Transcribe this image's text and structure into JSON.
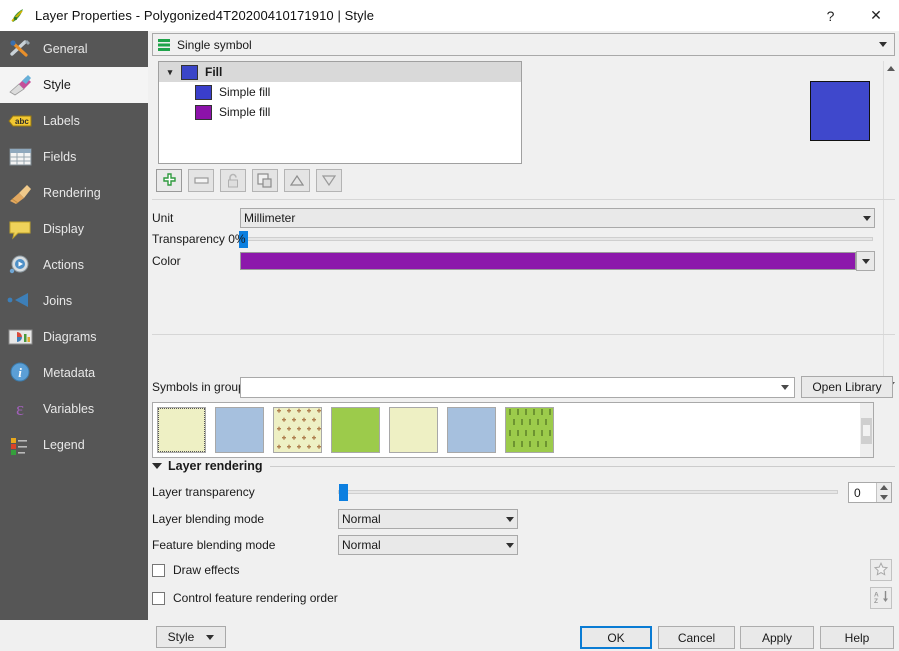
{
  "window": {
    "title": "Layer Properties - Polygonized4T20200410171910 | Style",
    "help_btn": "?",
    "close_btn": "✕",
    "icon": "qgis-logo-icon"
  },
  "sidebar": {
    "items": [
      {
        "label": "General",
        "icon": "tools-icon",
        "active": false
      },
      {
        "label": "Style",
        "icon": "paintbrush-icon",
        "active": true
      },
      {
        "label": "Labels",
        "icon": "abc-label-icon",
        "active": false
      },
      {
        "label": "Fields",
        "icon": "table-icon",
        "active": false
      },
      {
        "label": "Rendering",
        "icon": "broom-icon",
        "active": false
      },
      {
        "label": "Display",
        "icon": "speech-bubble-icon",
        "active": false
      },
      {
        "label": "Actions",
        "icon": "gear-play-icon",
        "active": false
      },
      {
        "label": "Joins",
        "icon": "join-arrow-icon",
        "active": false
      },
      {
        "label": "Diagrams",
        "icon": "chart-icon",
        "active": false
      },
      {
        "label": "Metadata",
        "icon": "info-icon",
        "active": false
      },
      {
        "label": "Variables",
        "icon": "epsilon-icon",
        "active": false
      },
      {
        "label": "Legend",
        "icon": "legend-icon",
        "active": false
      }
    ]
  },
  "renderer": {
    "selected": "Single symbol",
    "icon": "single-symbol-icon"
  },
  "symbol_tree": {
    "root": {
      "label": "Fill",
      "color": "#3a45c8",
      "expanded": true
    },
    "children": [
      {
        "label": "Simple fill",
        "color": "#3a3ecb"
      },
      {
        "label": "Simple fill",
        "color": "#8c12aa"
      }
    ]
  },
  "preview": {
    "color": "#3f48cc",
    "border": "#000000"
  },
  "symbol_toolbar": [
    {
      "name": "add-symbol-layer-button",
      "icon": "plus-icon",
      "enabled": true
    },
    {
      "name": "remove-symbol-layer-button",
      "icon": "minus-icon",
      "enabled": true
    },
    {
      "name": "lock-layer-button",
      "icon": "lock-icon",
      "enabled": false
    },
    {
      "name": "duplicate-layer-button",
      "icon": "duplicate-icon",
      "enabled": true
    },
    {
      "name": "move-up-button",
      "icon": "triangle-up-icon",
      "enabled": true
    },
    {
      "name": "move-down-button",
      "icon": "triangle-down-icon",
      "enabled": true
    }
  ],
  "properties": {
    "unit_label": "Unit",
    "unit_value": "Millimeter",
    "transparency_label": "Transparency 0%",
    "transparency_value": 0,
    "color_label": "Color",
    "color_value": "#8c18ab"
  },
  "symbols_group": {
    "label": "Symbols in group",
    "value": "",
    "open_library_label": "Open Library"
  },
  "gallery": {
    "swatches": [
      {
        "fill": "#eef0c4",
        "pattern": "none",
        "selected": true
      },
      {
        "fill": "#a6c0de",
        "pattern": "none",
        "selected": false
      },
      {
        "fill": "#eef0c4",
        "pattern": "cross",
        "selected": false
      },
      {
        "fill": "#9ccb4b",
        "pattern": "none",
        "selected": false
      },
      {
        "fill": "#eef0c4",
        "pattern": "none",
        "selected": false
      },
      {
        "fill": "#a6c0de",
        "pattern": "none",
        "selected": false
      },
      {
        "fill": "#9ccb4b",
        "pattern": "dashes",
        "selected": false
      }
    ]
  },
  "layer_rendering": {
    "title": "Layer rendering",
    "expanded": true,
    "transparency_label": "Layer transparency",
    "transparency_value": "0",
    "layer_blend_label": "Layer blending mode",
    "layer_blend_value": "Normal",
    "feature_blend_label": "Feature blending mode",
    "feature_blend_value": "Normal",
    "draw_effects_label": "Draw effects",
    "draw_effects_checked": false,
    "control_order_label": "Control feature rendering order",
    "control_order_checked": false,
    "effects_button_icon": "star-icon",
    "order_button_icon": "sort-az-icon"
  },
  "footer": {
    "style_label": "Style",
    "ok_label": "OK",
    "cancel_label": "Cancel",
    "apply_label": "Apply",
    "help_label": "Help"
  }
}
